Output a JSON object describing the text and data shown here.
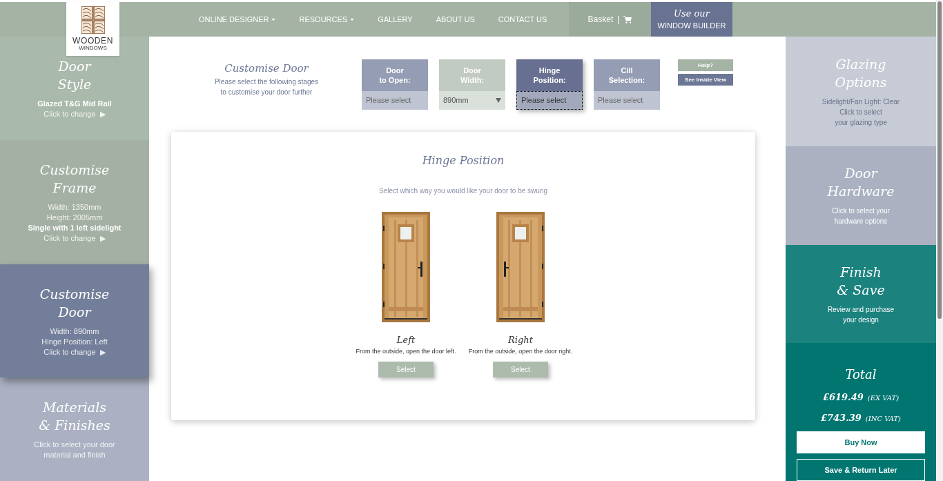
{
  "logo": {
    "name": "WOODEN",
    "tagline": "WINDOWS"
  },
  "nav": [
    {
      "label": "ONLINE DESIGNER",
      "dropdown": true
    },
    {
      "label": "RESOURCES",
      "dropdown": true
    },
    {
      "label": "GALLERY",
      "dropdown": false
    },
    {
      "label": "ABOUT US",
      "dropdown": false
    },
    {
      "label": "CONTACT US",
      "dropdown": false
    }
  ],
  "basket": {
    "label": "Basket",
    "separator": "|"
  },
  "builder": {
    "line1": "Use our",
    "line2": "WINDOW BUILDER"
  },
  "left_panels": [
    {
      "title": [
        "Door",
        "Style"
      ],
      "lines": [
        {
          "text": "Glazed T&G Mid Rail",
          "bold": true
        }
      ],
      "link": "Click to change",
      "arrow": "▶",
      "selected": false,
      "color": "#a9b9ab"
    },
    {
      "title": [
        "Customise",
        "Frame"
      ],
      "lines": [
        {
          "text": "Width: 1350mm",
          "bold": false
        },
        {
          "text": "Height: 2005mm",
          "bold": false
        },
        {
          "text": "Single with 1 left sidelight",
          "bold": true
        }
      ],
      "link": "Click to change",
      "arrow": "▶",
      "selected": false,
      "color": "#a4b0a3"
    },
    {
      "title": [
        "Customise",
        "Door"
      ],
      "lines": [
        {
          "text": "Width: 890mm",
          "bold": false
        },
        {
          "text": "Hinge Position: Left",
          "bold": false
        }
      ],
      "link": "Click to change",
      "arrow": "▶",
      "selected": true,
      "color": "#737f9a"
    },
    {
      "title": [
        "Materials",
        "& Finishes"
      ],
      "lines": [
        {
          "text": "Click to select your door",
          "bold": false
        },
        {
          "text": "material and finish",
          "bold": false
        }
      ],
      "selected": false,
      "color": "#abb1c2"
    }
  ],
  "intro": {
    "title": "Customise Door",
    "text": [
      "Please select the following stages",
      "to customise your door further"
    ]
  },
  "steps": [
    {
      "label": [
        "Door",
        "to Open:"
      ],
      "placeholder": "Please select",
      "dropdown": false,
      "selected": false,
      "color": "#959db4"
    },
    {
      "label": [
        "Door",
        "Width:"
      ],
      "value": "890mm",
      "dropdown": true,
      "selected": false,
      "color": "#c2cbc1"
    },
    {
      "label": [
        "Hinge",
        "Position:"
      ],
      "placeholder": "Please select",
      "dropdown": false,
      "selected": true,
      "color": "#677091"
    },
    {
      "label": [
        "Cill",
        "Selection:"
      ],
      "placeholder": "Please select",
      "dropdown": false,
      "selected": false,
      "color": "#959db4"
    }
  ],
  "help_buttons": [
    {
      "label": "Help?",
      "color": "#a4b3a4"
    },
    {
      "label": "See Inside View",
      "color": "#6c7795"
    }
  ],
  "card": {
    "title": "Hinge Position",
    "subtitle": "Select which way you would like your door to be swung",
    "options": [
      {
        "name": "Left",
        "description": "From the outside, open the door left.",
        "button": "Select"
      },
      {
        "name": "Right",
        "description": "From the outside, open the door right.",
        "button": "Select"
      }
    ]
  },
  "right_panels": [
    {
      "title": [
        "Glazing",
        "Options"
      ],
      "lines": [
        "Sidelight/Fan Light: Clear",
        "Click to select",
        "your glazing type"
      ],
      "color": "#c7cbd6"
    },
    {
      "title": [
        "Door",
        "Hardware"
      ],
      "lines": [
        "Click to select your",
        "hardware options"
      ],
      "color": "#abb1c1"
    },
    {
      "title": [
        "Finish",
        "& Save"
      ],
      "lines": [
        "Review and purchase",
        "your design"
      ],
      "color": "#1b827e"
    }
  ],
  "total": {
    "title": "Total",
    "prices": [
      {
        "amount": "£619.49",
        "note": "(EX VAT)"
      },
      {
        "amount": "£743.39",
        "note": "(INC VAT)"
      }
    ],
    "buy": "Buy Now",
    "save": "Save & Return Later"
  }
}
